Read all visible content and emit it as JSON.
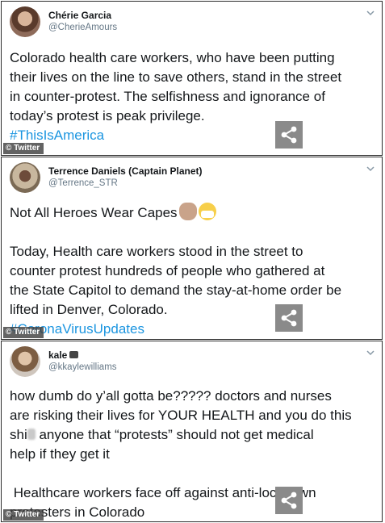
{
  "tweets": [
    {
      "name": "Chérie Garcia",
      "handle": "@CherieAmours",
      "lines": [
        "Colorado health care workers, who have been putting",
        "their lives on the line to save others, stand in the street",
        "in counter-protest. The selfishness and ignorance of",
        "today’s protest is peak privilege."
      ],
      "hashtag": "#ThisIsAmerica",
      "watermark": "© Twitter"
    },
    {
      "name": "Terrence Daniels (Captain Planet)",
      "handle": "@Terrence_STR",
      "headline": "Not All Heroes Wear Capes",
      "lines": [
        "Today, Health care workers stood  in the street to",
        "counter protest hundreds of people who gathered at",
        "the State Capitol to demand the stay-at-home order be",
        "lifted in Denver, Colorado."
      ],
      "hashtag": "#CoronaVirusUpdates",
      "watermark": "© Twitter"
    },
    {
      "name": "kale",
      "handle": "@kkaylewilliams",
      "lines": [
        "how dumb do y’all gotta be????? doctors and nurses",
        "are risking their lives for YOUR HEALTH and you do this",
        "shi",
        " anyone that “protests” should not get medical",
        "help if they get it"
      ],
      "lines2": [
        " Healthcare workers face off against anti-lockdown",
        "protesters in Colorado"
      ],
      "watermark": "© Twitter"
    }
  ],
  "icons": {
    "menu": "chevron-down-icon",
    "share": "share-icon"
  },
  "colors": {
    "hashtag": "#1b95e0",
    "handle": "#657786",
    "share_bg": "#8a8a8a"
  }
}
